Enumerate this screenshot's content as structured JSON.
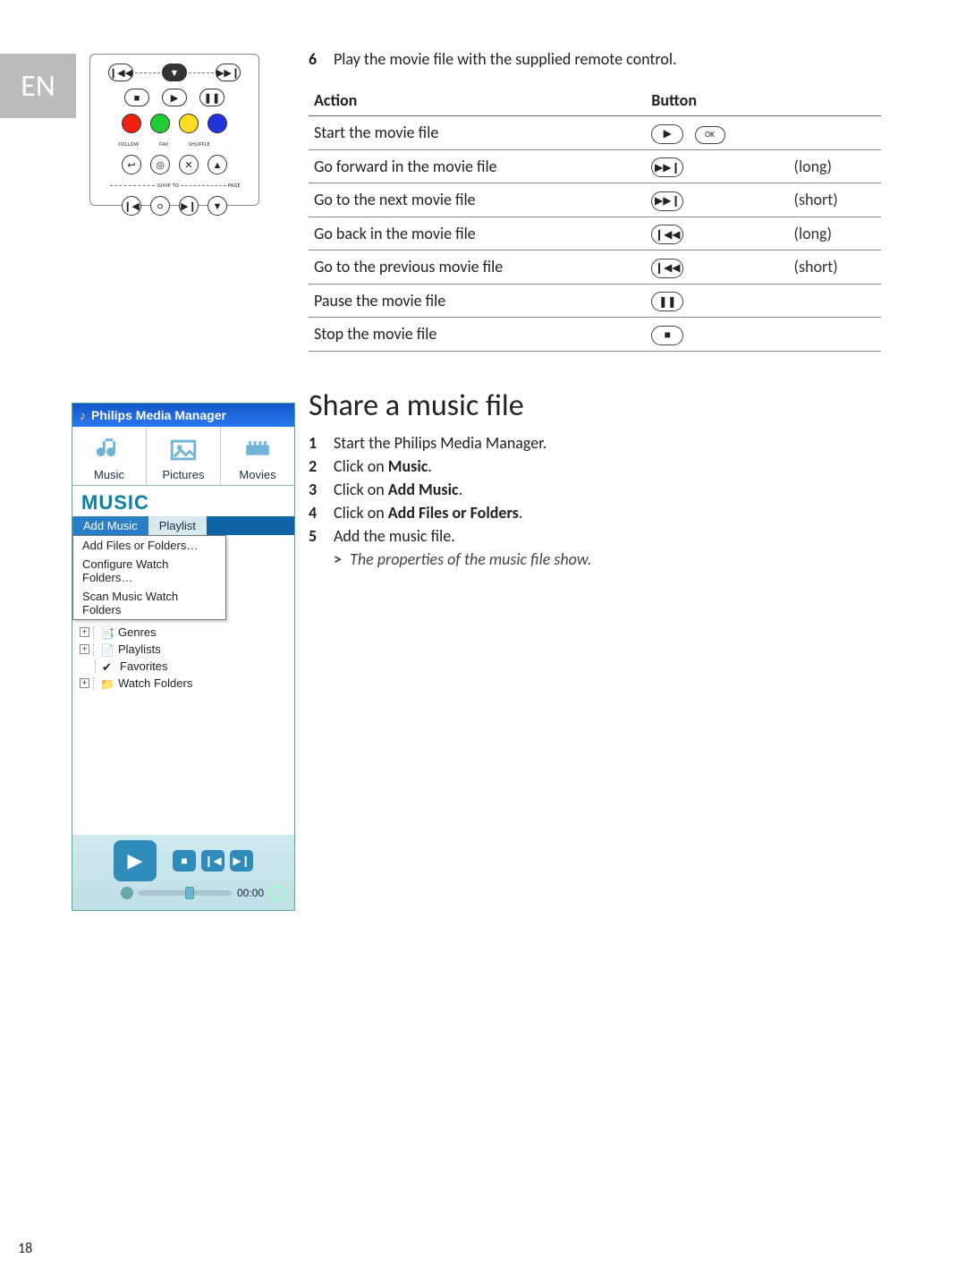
{
  "lang_tab": "EN",
  "step6": {
    "num": "6",
    "text": "Play the movie file with the supplied remote control."
  },
  "table": {
    "headers": {
      "action": "Action",
      "button": "Button"
    },
    "rows": [
      {
        "action": "Start the movie file",
        "icon1": "play",
        "icon2": "ok",
        "extra": ""
      },
      {
        "action": "Go forward in the movie file",
        "icon1": "next",
        "icon2": "",
        "extra": "(long)"
      },
      {
        "action": "Go to the next movie file",
        "icon1": "next",
        "icon2": "",
        "extra": "(short)"
      },
      {
        "action": "Go back in the movie file",
        "icon1": "prev",
        "icon2": "",
        "extra": "(long)"
      },
      {
        "action": "Go to the previous movie file",
        "icon1": "prev",
        "icon2": "",
        "extra": "(short)"
      },
      {
        "action": "Pause the movie file",
        "icon1": "pause",
        "icon2": "",
        "extra": ""
      },
      {
        "action": "Stop the movie file",
        "icon1": "stop",
        "icon2": "",
        "extra": ""
      }
    ]
  },
  "section_title": "Share a music file",
  "steps": [
    {
      "num": "1",
      "pre": "Start the Philips Media Manager.",
      "bold": "",
      "post": ""
    },
    {
      "num": "2",
      "pre": "Click on ",
      "bold": "Music",
      "post": "."
    },
    {
      "num": "3",
      "pre": "Click on ",
      "bold": "Add Music",
      "post": "."
    },
    {
      "num": "4",
      "pre": "Click on ",
      "bold": "Add Files or Folders",
      "post": "."
    },
    {
      "num": "5",
      "pre": "Add the music file.",
      "bold": "",
      "post": ""
    }
  ],
  "result": {
    "marker": ">",
    "text": "The properties of the music file show."
  },
  "pmm": {
    "title": "Philips Media Manager",
    "tabs": [
      {
        "label": "Music",
        "name": "music-tab"
      },
      {
        "label": "Pictures",
        "name": "pictures-tab"
      },
      {
        "label": "Movies",
        "name": "movies-tab"
      }
    ],
    "category": "MUSIC",
    "subtabs": {
      "active": "Add Music",
      "inactive": "Playlist"
    },
    "menu": [
      "Add Files or Folders…",
      "Configure Watch Folders…",
      "Scan Music Watch Folders"
    ],
    "tree": [
      {
        "label": "Genres"
      },
      {
        "label": "Playlists"
      },
      {
        "label": "Favorites"
      },
      {
        "label": "Watch Folders"
      }
    ],
    "time": "00:00"
  },
  "page_number": "18"
}
